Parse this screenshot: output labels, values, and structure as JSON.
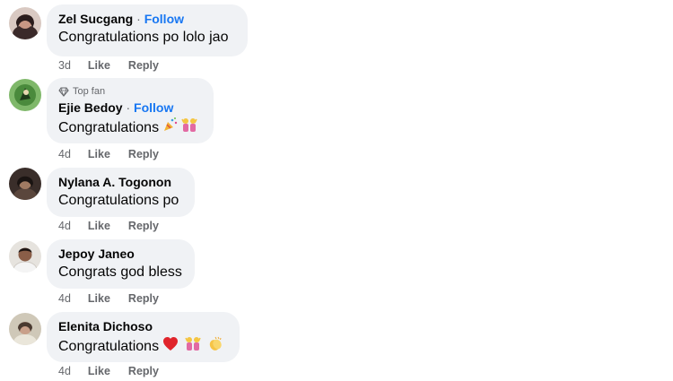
{
  "comments": [
    {
      "name": "Zel Sucgang",
      "separator": "·",
      "follow": "Follow",
      "text": "Congratulations po lolo jao",
      "time": "3d",
      "like": "Like",
      "reply": "Reply"
    },
    {
      "badge": "Top fan",
      "name": "Ejie Bedoy",
      "separator": "·",
      "follow": "Follow",
      "text": "Congratulations",
      "emojis": [
        "party-popper-icon",
        "celebrating-people-icon"
      ],
      "time": "4d",
      "like": "Like",
      "reply": "Reply"
    },
    {
      "name": "Nylana A. Togonon",
      "text": "Congratulations po",
      "time": "4d",
      "like": "Like",
      "reply": "Reply"
    },
    {
      "name": "Jepoy Janeo",
      "text": "Congrats god bless",
      "time": "4d",
      "like": "Like",
      "reply": "Reply"
    },
    {
      "name": "Elenita Dichoso",
      "text": "Congratulations",
      "emojis": [
        "red-heart-icon",
        "celebrating-people-icon",
        "clapping-hands-icon"
      ],
      "time": "4d",
      "like": "Like",
      "reply": "Reply"
    }
  ],
  "colors": {
    "bubble": "#f0f2f5",
    "follow": "#1877f2",
    "secondary_text": "#65676b"
  }
}
